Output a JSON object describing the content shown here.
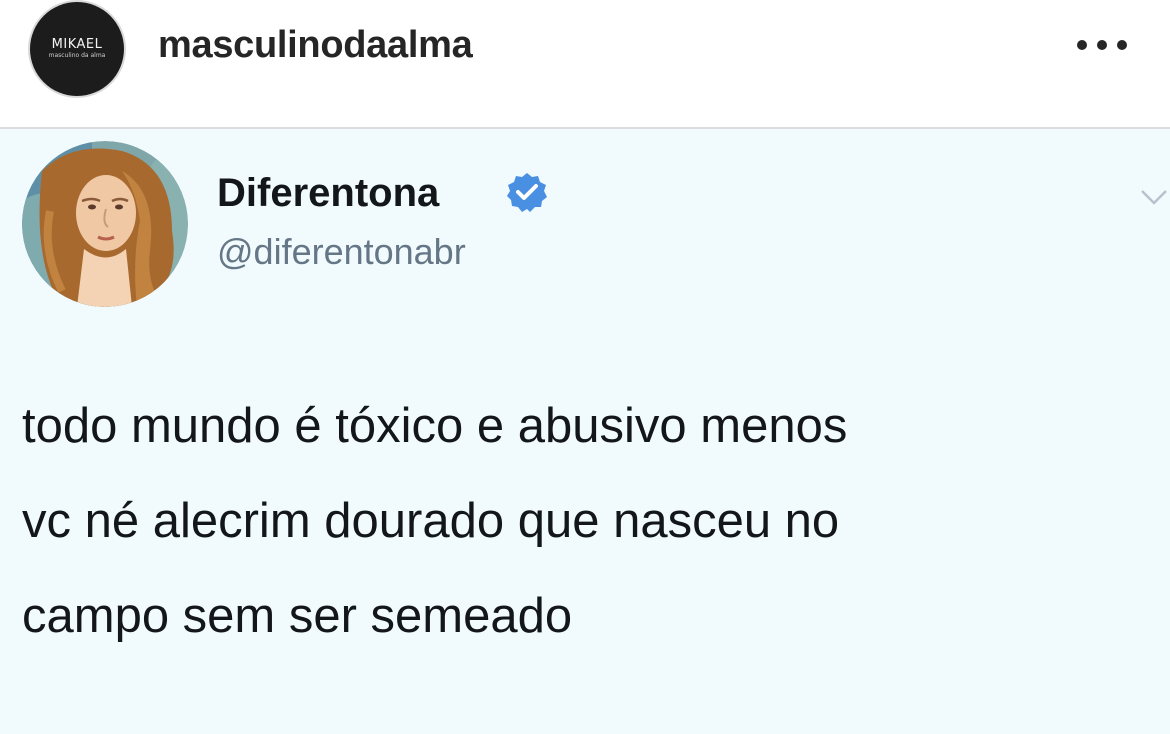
{
  "post": {
    "avatar_name": "MIKAEL",
    "avatar_sub": "masculino da alma",
    "username": "masculinodaalma",
    "more_icon": "more-dots-icon"
  },
  "tweet": {
    "display_name": "Diferentona",
    "handle": "@diferentonabr",
    "verified_icon": "verified-badge-icon",
    "chevron_icon": "chevron-down-icon",
    "text_lines": [
      "todo mundo é tóxico e abusivo menos",
      "vc né alecrim dourado que nasceu no",
      "campo sem ser semeado"
    ]
  },
  "colors": {
    "tweet_background": "#f1fbfd",
    "verified_blue": "#4a90e2",
    "handle_gray": "#657786",
    "text_dark": "#14171a"
  }
}
